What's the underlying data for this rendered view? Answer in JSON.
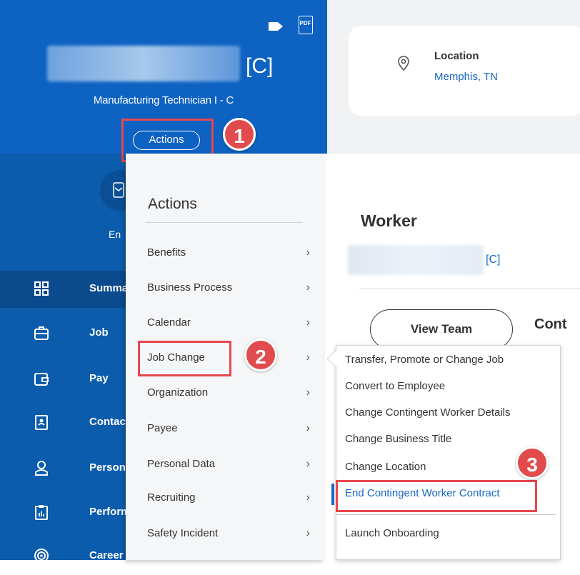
{
  "header": {
    "name_suffix": "[C]",
    "job_title": "Manufacturing Technician I - C",
    "actions_label": "Actions",
    "pdf_label": "PDF"
  },
  "contact_partial": "En",
  "nav": [
    {
      "label": "Summary",
      "icon": "grid-icon"
    },
    {
      "label": "Job",
      "icon": "briefcase-icon"
    },
    {
      "label": "Pay",
      "icon": "wallet-icon"
    },
    {
      "label": "Contact",
      "icon": "contact-card-icon"
    },
    {
      "label": "Personal",
      "icon": "person-icon"
    },
    {
      "label": "Performance",
      "icon": "clipboard-chart-icon"
    },
    {
      "label": "Career",
      "icon": "target-icon"
    }
  ],
  "location": {
    "label": "Location",
    "value": "Memphis, TN"
  },
  "actions_menu": {
    "title": "Actions",
    "items": [
      "Benefits",
      "Business Process",
      "Calendar",
      "Job Change",
      "Organization",
      "Payee",
      "Personal Data",
      "Recruiting",
      "Safety Incident"
    ]
  },
  "worker": {
    "title": "Worker",
    "suffix": "[C]",
    "view_team": "View Team",
    "cont_label": "Cont"
  },
  "submenu": {
    "items": [
      "Transfer, Promote or Change Job",
      "Convert to Employee",
      "Change Contingent Worker Details",
      "Change Business Title",
      "Change Location",
      "End Contingent Worker Contract",
      "Launch Onboarding"
    ]
  },
  "steps": [
    "1",
    "2",
    "3"
  ],
  "colors": {
    "sidebar": "#0b5cad",
    "header": "#0d62c2",
    "accent_red": "#e14b4d",
    "link_blue": "#1767c5"
  }
}
